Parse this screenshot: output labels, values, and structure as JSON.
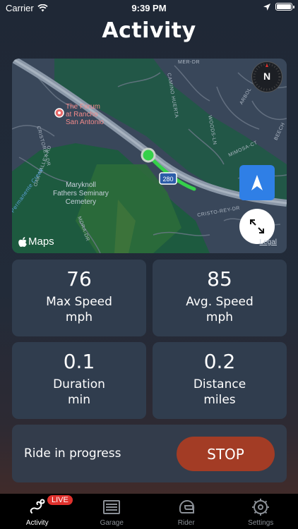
{
  "status_bar": {
    "carrier": "Carrier",
    "time": "9:39 PM"
  },
  "header": {
    "title": "Activity"
  },
  "map": {
    "poi_name": "The Forum\nat Rancho\nSan Antonio",
    "poi_line1": "The Forum",
    "poi_line2": "at Rancho",
    "poi_line3": "San Antonio",
    "cemetery_line1": "Maryknoll",
    "cemetery_line2": "Fathers Seminary",
    "cemetery_line3": "Cemetery",
    "highway_shield": "280",
    "streets": [
      "CRISTOREY-DR",
      "OAK-VALLEY-RD",
      "CRISTO-REY-DR",
      "MORA-DR",
      "WOODS-LN",
      "MIMOSA-CT",
      "ARBOL",
      "BEECH",
      "CAMINO HUERTA",
      "MER-DR",
      "Permanente Creek"
    ],
    "compass_label": "N",
    "attribution": "Maps",
    "legal": "Legal"
  },
  "stats": {
    "max_speed": {
      "value": "76",
      "label": "Max Speed",
      "unit": "mph"
    },
    "avg_speed": {
      "value": "85",
      "label": "Avg. Speed",
      "unit": "mph"
    },
    "duration": {
      "value": "0.1",
      "label": "Duration",
      "unit": "min"
    },
    "distance": {
      "value": "0.2",
      "label": "Distance",
      "unit": "miles"
    }
  },
  "ride": {
    "status": "Ride in progress",
    "stop_label": "STOP"
  },
  "tabs": [
    {
      "label": "Activity",
      "icon": "route-icon",
      "active": true
    },
    {
      "label": "Garage",
      "icon": "garage-icon",
      "active": false
    },
    {
      "label": "Rider",
      "icon": "helmet-icon",
      "active": false
    },
    {
      "label": "Settings",
      "icon": "gear-icon",
      "active": false
    }
  ],
  "live_badge": "LIVE",
  "colors": {
    "stop": "#a33c25",
    "card": "#303d4e",
    "location": "#2f7fe6",
    "route": "#35d04a",
    "live": "#e0312d"
  }
}
